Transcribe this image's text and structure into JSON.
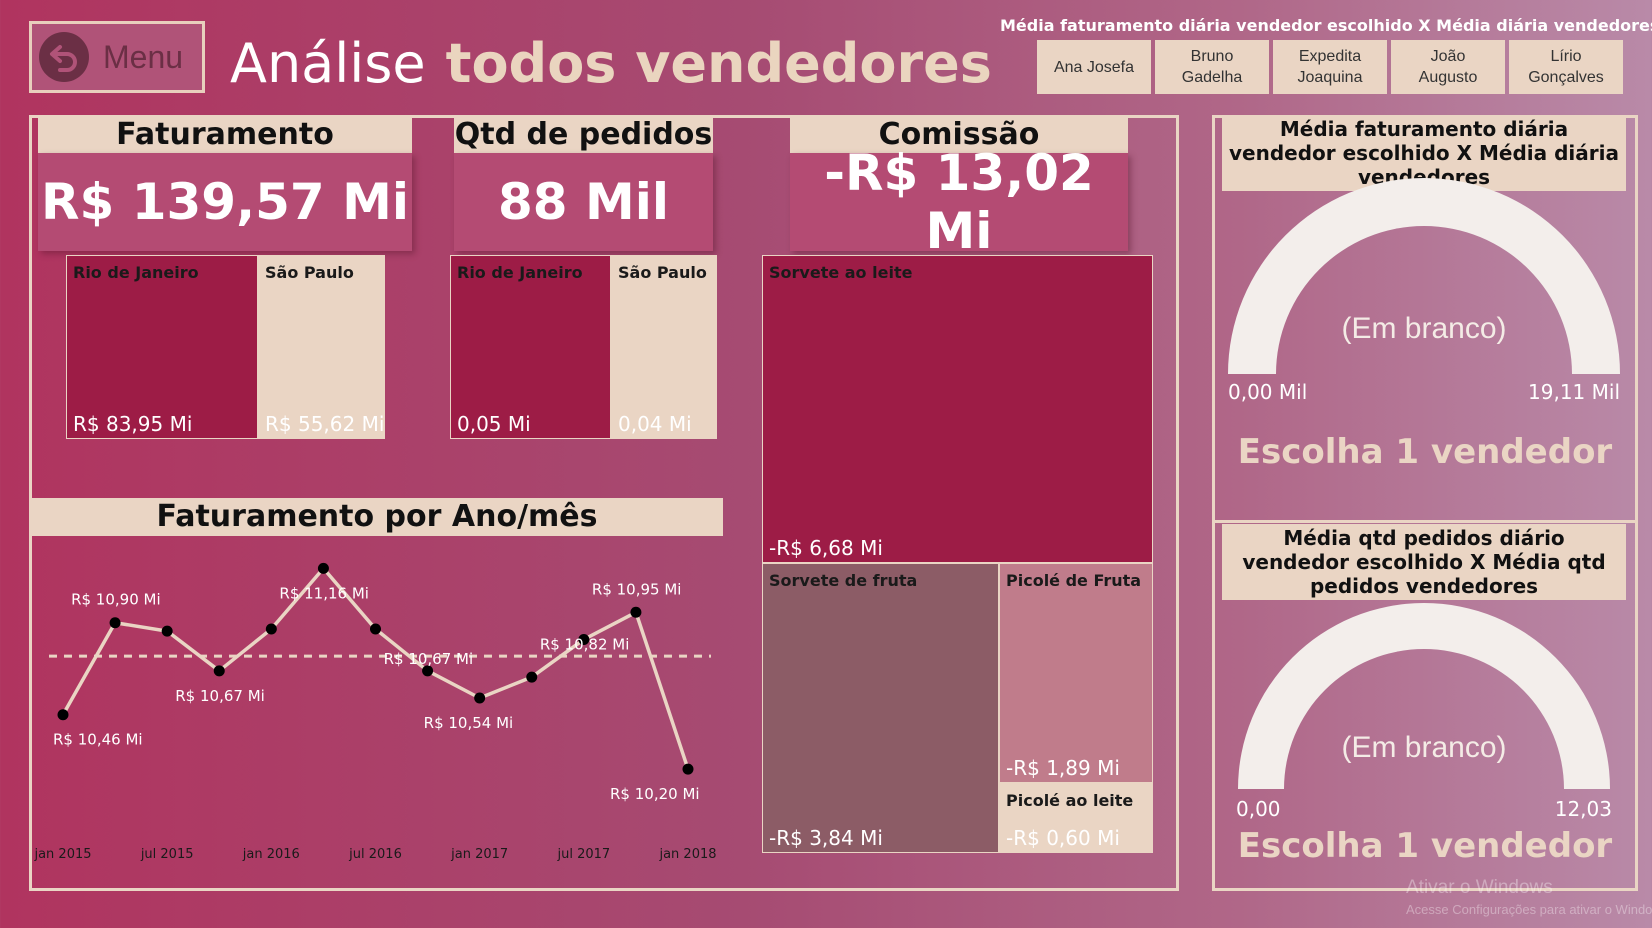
{
  "header": {
    "menu_label": "Menu",
    "title_part1": "Análise",
    "title_part2": "todos vendedores"
  },
  "slicer": {
    "title": "Média faturamento diária vendedor escolhido X Média diária vendedores",
    "options": [
      {
        "line1": "Ana Josefa",
        "line2": ""
      },
      {
        "line1": "Bruno",
        "line2": "Gadelha"
      },
      {
        "line1": "Expedita",
        "line2": "Joaquina"
      },
      {
        "line1": "João",
        "line2": "Augusto"
      },
      {
        "line1": "Lírio",
        "line2": "Gonçalves"
      }
    ]
  },
  "kpis": {
    "faturamento": {
      "label": "Faturamento",
      "value": "R$ 139,57 Mi"
    },
    "pedidos": {
      "label": "Qtd de pedidos",
      "value": "88 Mil"
    },
    "comissao": {
      "label": "Comissão",
      "value": "-R$ 13,02 Mi"
    }
  },
  "treemaps": {
    "faturamento_por_estado": [
      {
        "label": "Rio de Janeiro",
        "value": "R$ 83,95 Mi",
        "amount": 83.95
      },
      {
        "label": "São Paulo",
        "value": "R$ 55,62 Mi",
        "amount": 55.62
      }
    ],
    "pedidos_por_estado": [
      {
        "label": "Rio de Janeiro",
        "value": "0,05 Mi",
        "amount": 0.05
      },
      {
        "label": "São Paulo",
        "value": "0,04 Mi",
        "amount": 0.04
      }
    ],
    "comissao_por_produto": [
      {
        "label": "Sorvete ao leite",
        "value": "-R$ 6,68 Mi",
        "amount": -6.68
      },
      {
        "label": "Sorvete de fruta",
        "value": "-R$ 3,84 Mi",
        "amount": -3.84
      },
      {
        "label": "Picolé de Fruta",
        "value": "-R$ 1,89 Mi",
        "amount": -1.89
      },
      {
        "label": "Picolé ao leite",
        "value": "-R$ 0,60 Mi",
        "amount": -0.6
      }
    ]
  },
  "line_chart": {
    "title": "Faturamento por Ano/mês"
  },
  "chart_data": {
    "type": "line",
    "title": "Faturamento por Ano/mês",
    "x": [
      "jan 2015",
      "abr 2015",
      "jul 2015",
      "out 2015",
      "jan 2016",
      "abr 2016",
      "jul 2016",
      "out 2016",
      "jan 2017",
      "abr 2017",
      "jul 2017",
      "out 2017",
      "jan 2018"
    ],
    "values": [
      10.46,
      10.9,
      10.86,
      10.67,
      10.87,
      11.16,
      10.87,
      10.67,
      10.54,
      10.64,
      10.82,
      10.95,
      10.2
    ],
    "data_labels": [
      "R$ 10,46 Mi",
      "R$ 10,90 Mi",
      "",
      "R$ 10,67 Mi",
      "",
      "R$ 11,16 Mi",
      "",
      "R$ 10,67 Mi",
      "R$ 10,54 Mi",
      "",
      "R$ 10,82 Mi",
      "R$ 10,95 Mi",
      "R$ 10,20 Mi"
    ],
    "x_ticks": [
      "jan 2015",
      "jul 2015",
      "jan 2016",
      "jul 2016",
      "jan 2017",
      "jul 2017",
      "jan 2018"
    ],
    "average_line": 10.74,
    "ylim": [
      10.1,
      11.2
    ],
    "unit": "R$ Mi",
    "colors": {
      "line": "#ead5c4",
      "markers": "#000000",
      "average": "#ead5c4"
    }
  },
  "gauges": [
    {
      "title": "Média faturamento diária vendedor escolhido X Média diária vendedores",
      "center_text": "(Em branco)",
      "min": "0,00 Mil",
      "max": "19,11 Mil",
      "message": "Escolha 1 vendedor"
    },
    {
      "title": "Média qtd pedidos diário vendedor escolhido X Média qtd pedidos vendedores",
      "center_text": "(Em branco)",
      "min": "0,00",
      "max": "12,03",
      "message": "Escolha 1 vendedor"
    }
  ],
  "watermark": {
    "line1": "Ativar o Windows",
    "line2": "Acesse Configurações para ativar o Windows."
  },
  "colors": {
    "accent_beige": "#ead5c4",
    "tile_dark": "#9d1c46",
    "tile_brown": "#8c5c66",
    "tile_rose": "#c07c8b"
  }
}
